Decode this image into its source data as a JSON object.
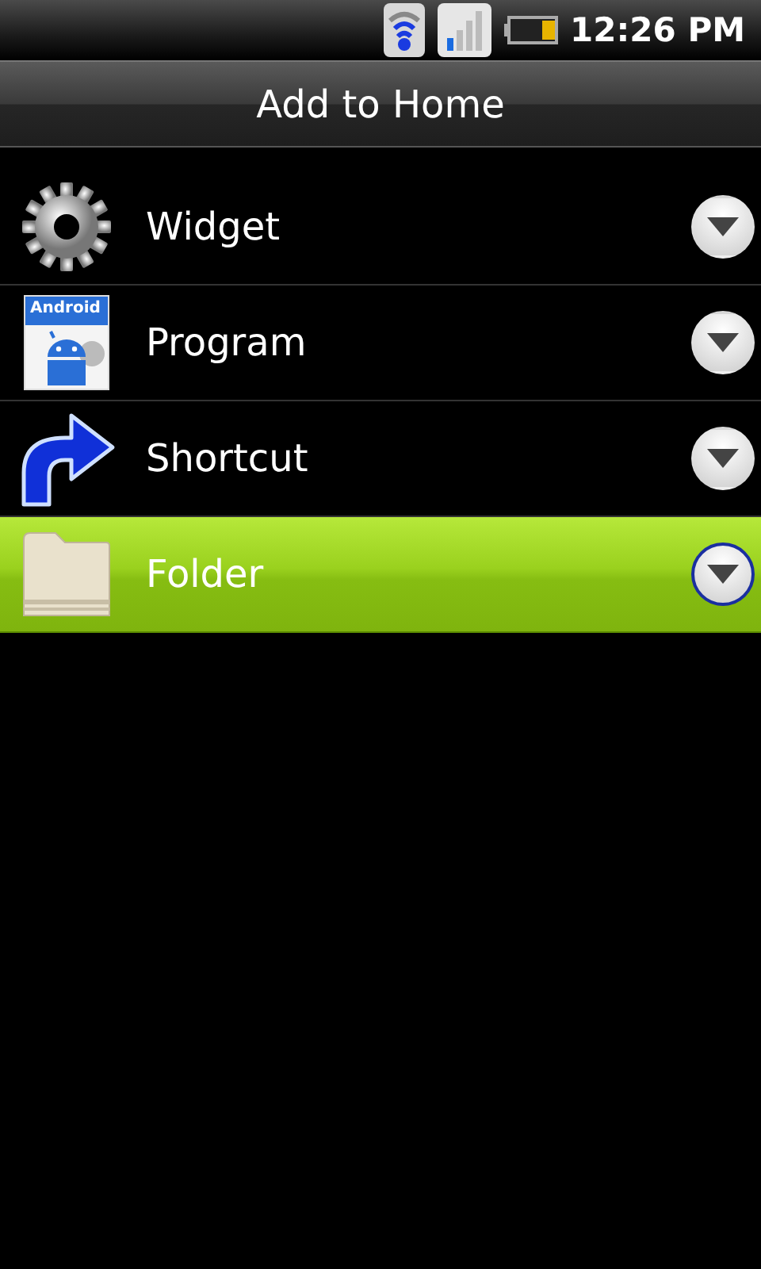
{
  "status_bar": {
    "time": "12:26 PM"
  },
  "title": "Add to Home",
  "items": [
    {
      "label": "Widget",
      "kind": "gear",
      "selected": false
    },
    {
      "label": "Program",
      "kind": "app",
      "icon_label": "Android",
      "selected": false
    },
    {
      "label": "Shortcut",
      "kind": "arrow",
      "selected": false
    },
    {
      "label": "Folder",
      "kind": "folder",
      "selected": true
    }
  ]
}
